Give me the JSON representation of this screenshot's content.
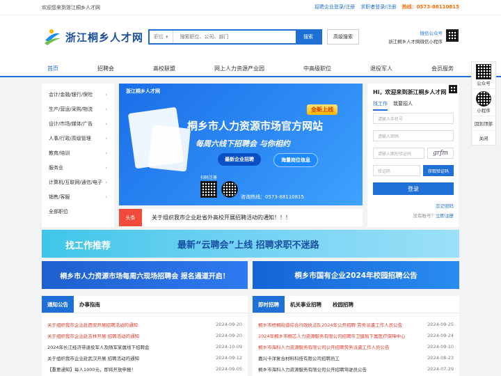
{
  "topbar": {
    "welcome": "欢迎您来到浙江桐乡人才网",
    "company_login": "招聘企业登录/注册",
    "seeker_login": "求职者登录/注册",
    "hotline": "热线：0573-88110815"
  },
  "header": {
    "logo_text": "浙江桐乡人才网",
    "search_category": "职位",
    "search_placeholder": "搜索职位、公司、部门",
    "search_button": "搜索",
    "advanced_search": "高级搜索",
    "wechat_label": "微信公众号",
    "miniprogram_label": "浙江桐乡人才网微信小程序"
  },
  "nav": {
    "items": [
      "首页",
      "招聘会",
      "高校联盟",
      "网上人力资源产业园",
      "中高级职位",
      "退役军人",
      "会员服务"
    ]
  },
  "categories": [
    "会计/金融/银行/保险",
    "生产/营运/采购/物流",
    "设计/市场/媒体/广告",
    "人事/行政/高级管理",
    "教育/培训",
    "服务业",
    "计算机/互联网/通信/电子",
    "销售/客服",
    "全部职位"
  ],
  "banner": {
    "logo_text": "浙江桐乡人才网",
    "badge": "全新上线",
    "title": "桐乡市人力资源市场官方网站",
    "subtitle": "每周六线下招聘会 与你相约",
    "pill1": "最新企业招聘",
    "pill2": "海量岗位信息",
    "scan_text": "扫码注册",
    "hotline": "咨询热线：0573-88110815"
  },
  "headline": {
    "tag": "头条",
    "text": "关于组织我市企业赴省外高校开展招聘活动的通知！！！"
  },
  "login": {
    "greeting": "Hi，欢迎来到浙江桐乡人才网",
    "tab_seeker": "找工作",
    "tab_company": "我要招人",
    "phone_placeholder": "请输入手机号",
    "password_placeholder": "请输入密码",
    "captcha_placeholder": "请输入图形验证码",
    "captcha_text": "grfm",
    "sms_placeholder": "验证码",
    "get_code": "获取验证码",
    "login_button": "登录",
    "forgot": "忘记密码",
    "no_account": "没有账号？",
    "register": "立即注册"
  },
  "ribbon": {
    "left": "找工作推荐",
    "right": "最新“云聘会”上线  招聘求职不迷路"
  },
  "banners": {
    "left": "桐乡市人力资源市场每周六现场招聘会  报名通道开启！",
    "right": "桐乡市国有企业2024年校园招聘公告"
  },
  "notices": {
    "tabs": [
      "通知公告",
      "办事指南"
    ],
    "items": [
      {
        "title": "关于组织我市企业赴西安开展招聘活动的通知",
        "date": "2024-09-20"
      },
      {
        "title": "关于组织我市企业赴吉林开展 招聘活动的通知",
        "date": "2024-09-20"
      },
      {
        "title": "2024年长江经济带退役军人及随军家属线下招聘会",
        "date": "2024-10-09"
      },
      {
        "title": "关于组织我市企业赴武汉开展 招聘活动的通知",
        "date": "2024-09-12"
      },
      {
        "title": "【重要通知】每人1000元，即将开放申报！",
        "date": "2024-09-05"
      }
    ]
  },
  "jobs": {
    "tabs": [
      "即时招聘",
      "机关事业招聘",
      "校园招聘"
    ],
    "items": [
      {
        "title": "桐乡市梧桐街道综合行政执法队2024年公开招聘 劳务派遣工作人员公告",
        "date": "2024-09-25"
      },
      {
        "title": "2024年桐乡市桐芯人力资源服务有限公司招聘市卫健局下属医疗保障中心",
        "date": "2024-09-24"
      },
      {
        "title": "桐乡市海科人力资源服务有限公司公开招聘劳务派遣工作人员公告",
        "date": "2024-09-10"
      },
      {
        "title": "嘉兴卡洋复合材料科技有限公司招聘员工",
        "date": "2024-08-23"
      },
      {
        "title": "桐乡市海科人力资源服务有限公司公开招聘驾驶员公告",
        "date": "2024-07-29"
      }
    ]
  },
  "side": {
    "wechat": "公众号",
    "mini": "小程序",
    "back_top": "回到顶部",
    "close": "关闭"
  }
}
